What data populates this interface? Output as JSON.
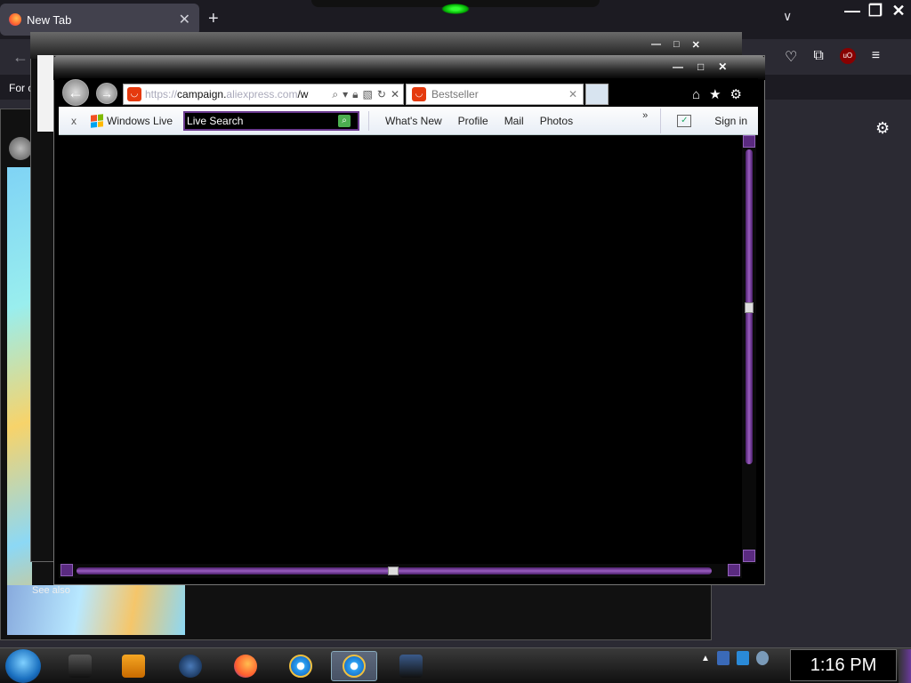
{
  "firefox": {
    "tab_title": "New Tab",
    "bookmark_text": "For c",
    "icons": [
      "firefox-icon",
      "close-icon",
      "plus-icon",
      "chevron-down-icon",
      "minimize-icon",
      "restore-icon",
      "close-icon",
      "back-arrow-icon",
      "pocket-icon",
      "extensions-icon",
      "ublock-icon",
      "menu-icon",
      "gear-icon"
    ]
  },
  "back_window": {
    "see_also": "See also"
  },
  "ie": {
    "address": {
      "url_dim": "https://",
      "url_main": "campaign.",
      "url_tail": "aliexpress.com",
      "url_rest": "/w"
    },
    "tab": {
      "title": "Bestseller"
    },
    "toolbar": {
      "close": "x",
      "brand": "Windows Live",
      "search_value": "Live Search",
      "links": [
        "What's New",
        "Profile",
        "Mail",
        "Photos"
      ],
      "more": "»",
      "sign_in": "Sign in"
    }
  },
  "taskbar": {
    "clock": "1:16 PM",
    "pinned": [
      "start-orb",
      "media-center-icon",
      "windows-media-player-icon",
      "network-globe-icon",
      "firefox-icon",
      "internet-explorer-icon",
      "internet-explorer-icon",
      "remote-desktop-icon"
    ]
  },
  "colors": {
    "accent_purple": "#6b3a8f",
    "firefox_bg": "#1c1b22",
    "aliexpress_red": "#e53a0e"
  }
}
